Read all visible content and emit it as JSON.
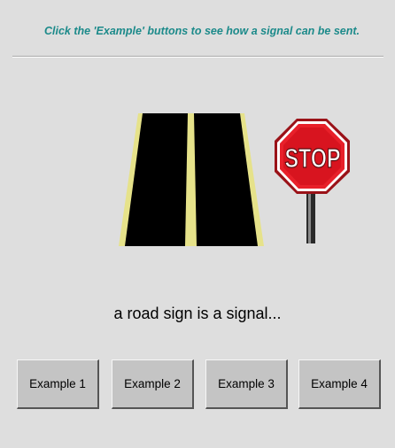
{
  "instruction": "Click the 'Example' buttons to see how a signal can be sent.",
  "illustration": {
    "road_image": "road-icon",
    "stop_sign": {
      "icon": "stop-sign-icon",
      "text": "STOP",
      "color": "#e8202a"
    }
  },
  "caption": "a road sign is a signal...",
  "buttons": [
    {
      "label": "Example 1"
    },
    {
      "label": "Example 2"
    },
    {
      "label": "Example 3"
    },
    {
      "label": "Example 4"
    }
  ],
  "colors": {
    "background": "#dedede",
    "instruction_text": "#1c8a8a",
    "road_edge": "#e6e28a",
    "button_face": "#c4c4c4"
  }
}
